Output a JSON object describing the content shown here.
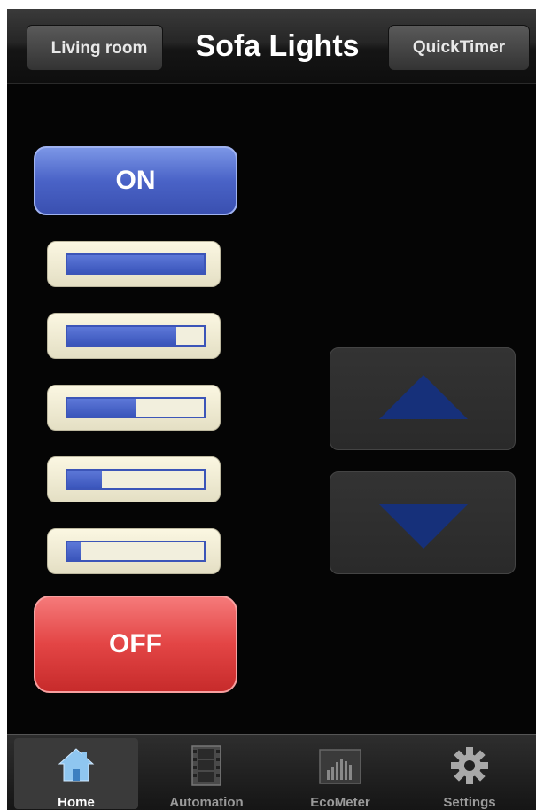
{
  "navbar": {
    "back_label": "Living room",
    "title": "Sofa Lights",
    "quick_label": "QuickTimer"
  },
  "controls": {
    "on_label": "ON",
    "off_label": "OFF",
    "levels": [
      1.0,
      0.8,
      0.5,
      0.25,
      0.1
    ]
  },
  "tabs": [
    {
      "label": "Home",
      "icon": "home-icon",
      "active": true
    },
    {
      "label": "Automation",
      "icon": "film-icon",
      "active": false
    },
    {
      "label": "EcoMeter",
      "icon": "bar-chart-icon",
      "active": false
    },
    {
      "label": "Settings",
      "icon": "gear-icon",
      "active": false
    }
  ],
  "colors": {
    "accent_blue": "#4a63c7",
    "off_red": "#e34545",
    "arrow_blue": "#16307a"
  }
}
